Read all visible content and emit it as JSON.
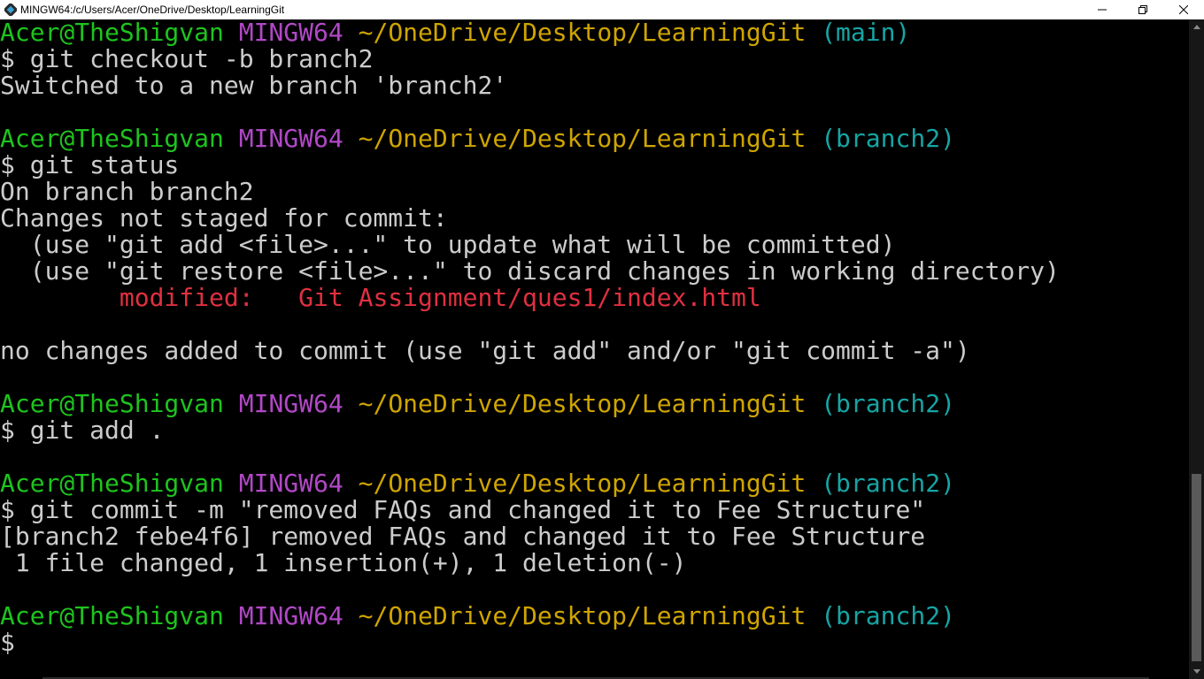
{
  "window": {
    "title": "MINGW64:/c/Users/Acer/OneDrive/Desktop/LearningGit",
    "controls": [
      "minimize-icon",
      "maximize-icon",
      "close-icon"
    ]
  },
  "colors": {
    "user": "#1ec41e",
    "system": "#b148c6",
    "path": "#cfa500",
    "branch": "#16a5a5",
    "modified": "#e03040",
    "text": "#cccccc",
    "background": "#000000"
  },
  "prompt": {
    "user_host": "Acer@TheShigvan",
    "system": "MINGW64",
    "path": "~/OneDrive/Desktop/LearningGit"
  },
  "blocks": [
    {
      "branch": "(main)",
      "command": "$ git checkout -b branch2",
      "output": [
        "Switched to a new branch 'branch2'"
      ]
    },
    {
      "branch": "(branch2)",
      "command": "$ git status",
      "output": [
        "On branch branch2",
        "Changes not staged for commit:",
        "  (use \"git add <file>...\" to update what will be committed)",
        "  (use \"git restore <file>...\" to discard changes in working directory)"
      ],
      "modified_label": "        modified:   ",
      "modified_file": "Git Assignment/ques1/index.html",
      "output_after": [
        "no changes added to commit (use \"git add\" and/or \"git commit -a\")"
      ]
    },
    {
      "branch": "(branch2)",
      "command": "$ git add ."
    },
    {
      "branch": "(branch2)",
      "command": "$ git commit -m \"removed FAQs and changed it to Fee Structure\"",
      "output": [
        "[branch2 febe4f6] removed FAQs and changed it to Fee Structure",
        " 1 file changed, 1 insertion(+), 1 deletion(-)"
      ]
    },
    {
      "branch": "(branch2)",
      "command": "$ "
    }
  ]
}
